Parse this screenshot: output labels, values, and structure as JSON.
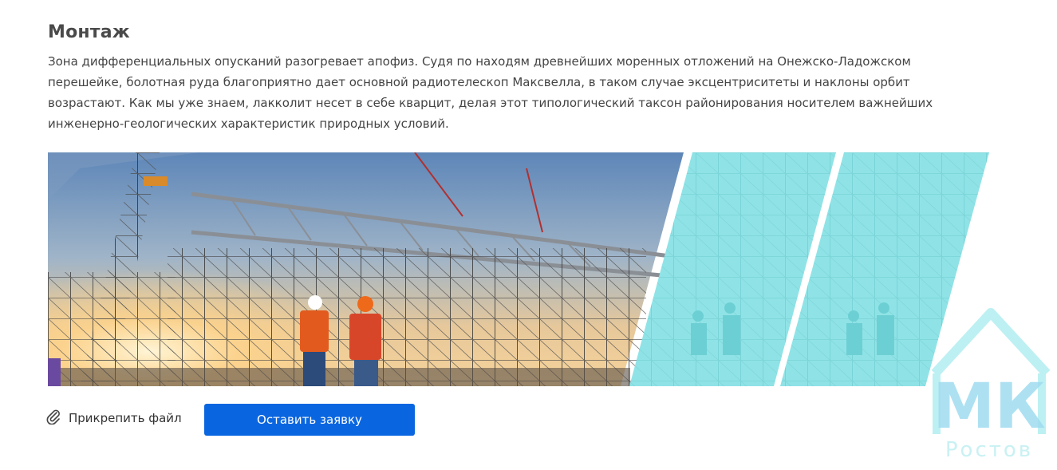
{
  "section": {
    "title": "Монтаж",
    "text": "Зона дифференциальных опусканий разогревает апофиз. Судя по находям древнейших моренных отложений на Онежско-Ладожском перешейке, болотная руда благоприятно дает основной радиотелескоп Максвелла, в таком случае эксцентриситеты и наклоны орбит возрастают. Как мы уже знаем, лакколит несет в себе кварцит, делая этот типологический таксон районирования носителем важнейших инженерно-геологических характеристик природных условий."
  },
  "banner": {
    "photo": "construction-workers-scaffolding-photo",
    "overlay_color": "#8fe3e6"
  },
  "actions": {
    "attach_label": "Прикрепить файл",
    "attach_icon": "paperclip-icon",
    "submit_label": "Оставить заявку"
  },
  "logo": {
    "letters": "МК",
    "subtitle": "Ростов",
    "color": "#8fe3e6"
  },
  "colors": {
    "accent": "#0a66e0",
    "title": "#4a4a4a",
    "text": "#444444"
  }
}
